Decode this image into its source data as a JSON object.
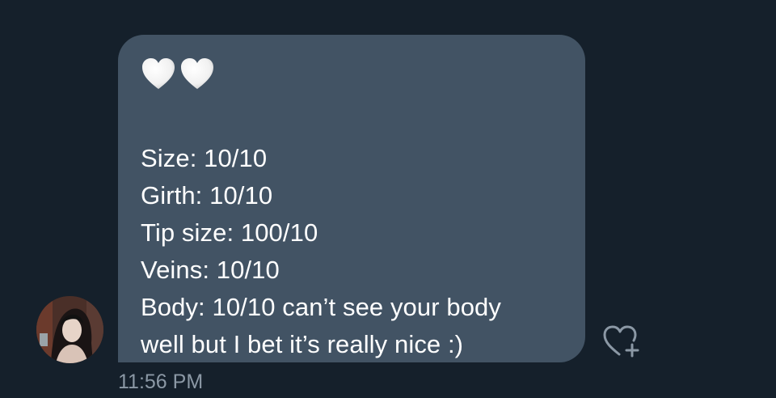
{
  "message": {
    "emoji": [
      "white-heart",
      "white-heart"
    ],
    "lines": [
      "Size: 10/10",
      "Girth: 10/10",
      "Tip size: 100/10",
      "Veins: 10/10",
      "Body: 10/10 can’t see your body",
      "well but I bet it’s really nice :)"
    ],
    "timestamp": "11:56 PM"
  },
  "sender": {
    "avatar_icon": "user-avatar-photo"
  },
  "reaction": {
    "icon": "heart-plus-icon"
  },
  "colors": {
    "background": "#15202b",
    "bubble": "#425364",
    "text": "#ffffff",
    "timestamp": "#8b98a5"
  }
}
